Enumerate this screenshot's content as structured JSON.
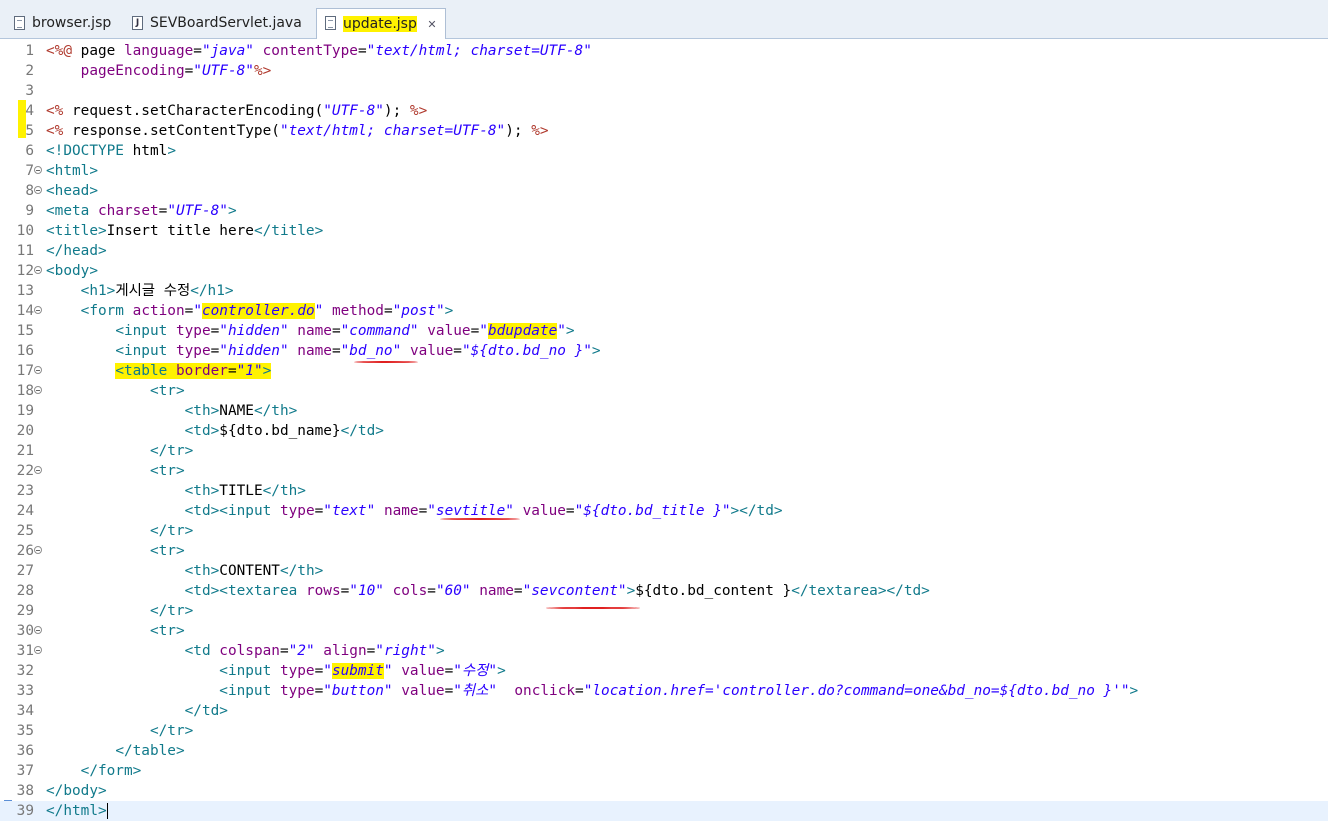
{
  "tabs": [
    {
      "label": "browser.jsp",
      "icon": "jsp-file-icon"
    },
    {
      "label": "SEVBoardServlet.java",
      "icon": "java-file-icon"
    },
    {
      "label": "update.jsp",
      "icon": "jsp-file-icon",
      "active": true
    }
  ],
  "tab_close_glyph": "✕",
  "colors": {
    "tag": "#117a8b",
    "attribute": "#7f007f",
    "value": "#2a00ff",
    "delimiter": "#b03a2e",
    "highlight": "#fff200",
    "annotation": "#e02020"
  },
  "line_numbers": [
    "1",
    "2",
    "3",
    "4",
    "5",
    "6",
    "7",
    "8",
    "9",
    "10",
    "11",
    "12",
    "13",
    "14",
    "15",
    "16",
    "17",
    "18",
    "19",
    "20",
    "21",
    "22",
    "23",
    "24",
    "25",
    "26",
    "27",
    "28",
    "29",
    "30",
    "31",
    "32",
    "33",
    "34",
    "35",
    "36",
    "37",
    "38",
    "39"
  ],
  "code_lines": [
    "<%@ page language=\"java\" contentType=\"text/html; charset=UTF-8\"",
    "    pageEncoding=\"UTF-8\"%>",
    "",
    "<% request.setCharacterEncoding(\"UTF-8\"); %>",
    "<% response.setContentType(\"text/html; charset=UTF-8\"); %>",
    "<!DOCTYPE html>",
    "<html>",
    "<head>",
    "<meta charset=\"UTF-8\">",
    "<title>Insert title here</title>",
    "</head>",
    "<body>",
    "    <h1>게시글 수정</h1>",
    "    <form action=\"controller.do\" method=\"post\">",
    "        <input type=\"hidden\" name=\"command\" value=\"bdupdate\">",
    "        <input type=\"hidden\" name=\"bd_no\" value=\"${dto.bd_no }\">",
    "        <table border=\"1\">",
    "            <tr>",
    "                <th>NAME</th>",
    "                <td>${dto.bd_name}</td>",
    "            </tr>",
    "            <tr>",
    "                <th>TITLE</th>",
    "                <td><input type=\"text\" name=\"sevtitle\" value=\"${dto.bd_title }\"></td>",
    "            </tr>",
    "            <tr>",
    "                <th>CONTENT</th>",
    "                <td><textarea rows=\"10\" cols=\"60\" name=\"sevcontent\">${dto.bd_content }</textarea></td>",
    "            </tr>",
    "            <tr>",
    "                <td colspan=\"2\" align=\"right\">",
    "                    <input type=\"submit\" value=\"수정\">",
    "                    <input type=\"button\" value=\"취소\"  onclick=\"location.href='controller.do?command=one&bd_no=${dto.bd_no }'\">",
    "                </td>",
    "            </tr>",
    "        </table>",
    "    </form>",
    "</body>",
    "</html>"
  ]
}
